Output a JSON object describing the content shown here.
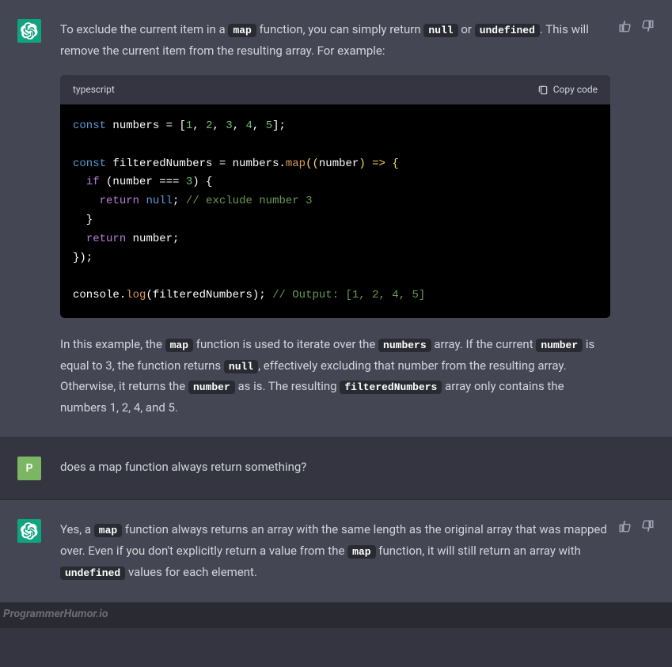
{
  "messages": {
    "m1": {
      "p1_before_map": "To exclude the current item in a ",
      "p1_map": "map",
      "p1_mid1": " function, you can simply return ",
      "p1_null": "null",
      "p1_or": " or ",
      "p1_undef": "undefined",
      "p1_after": ". This will remove the current item from the resulting array. For example:",
      "code_lang": "typescript",
      "copy_label": "Copy code",
      "code": {
        "l1_const": "const",
        "l1_numbers": "numbers",
        "l1_eq": " = [",
        "l1_n1": "1",
        "l1_n2": "2",
        "l1_n3": "3",
        "l1_n4": "4",
        "l1_n5": "5",
        "l1_end": "];",
        "l3_const": "const",
        "l3_fn": "filteredNumbers",
        "l3_eq": " = numbers.",
        "l3_map": "map",
        "l3_open": "((",
        "l3_param": "number",
        "l3_arrow": ") => {",
        "l4_if": "if",
        "l4_cond_open": " (number === ",
        "l4_three": "3",
        "l4_cond_close": ") {",
        "l5_return": "return",
        "l5_null": "null",
        "l5_semi": ";",
        "l5_comment": " // exclude number 3",
        "l6_close": "  }",
        "l7_return": "return",
        "l7_num": " number;",
        "l8_close": "});",
        "l10_console": "console",
        "l10_dot": ".",
        "l10_log": "log",
        "l10_open": "(filteredNumbers);",
        "l10_comment": " // Output: [1, 2, 4, 5]"
      },
      "p2_a": "In this example, the ",
      "p2_map": "map",
      "p2_b": " function is used to iterate over the ",
      "p2_numbers": "numbers",
      "p2_c": " array. If the current ",
      "p2_number": "number",
      "p2_d": " is equal to 3, the function returns ",
      "p2_null": "null",
      "p2_e": ", effectively excluding that number from the resulting array. Otherwise, it returns the ",
      "p2_number2": "number",
      "p2_f": " as is. The resulting ",
      "p2_filtered": "filteredNumbers",
      "p2_g": " array only contains the numbers 1, 2, 4, and 5."
    },
    "m2": {
      "avatar_letter": "P",
      "text": "does a map function always return something?"
    },
    "m3": {
      "p1_a": "Yes, a ",
      "p1_map": "map",
      "p1_b": " function always returns an array with the same length as the original array that was mapped over. Even if you don't explicitly return a value from the ",
      "p1_map2": "map",
      "p1_c": " function, it will still return an array with ",
      "p1_undef": "undefined",
      "p1_d": " values for each element."
    }
  },
  "watermark": "ProgrammerHumor.io"
}
